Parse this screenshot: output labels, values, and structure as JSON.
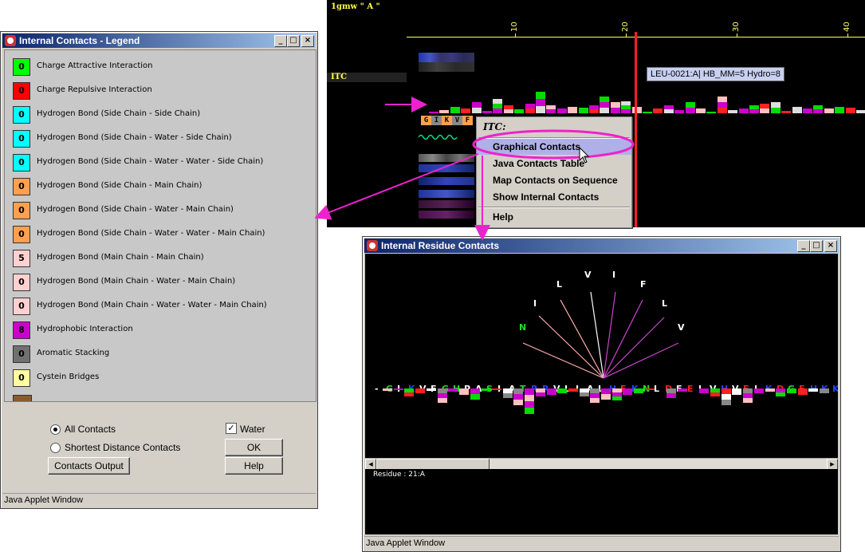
{
  "seqviewer": {
    "title": "1gmw \" A \"",
    "track_label": "ITC",
    "ruler_ticks": [
      "10",
      "20",
      "30",
      "40"
    ],
    "tooltip": "LEU-0021:A| HB_MM=5  Hydro=8",
    "sequence_letters": [
      "G",
      "I",
      "K",
      "V",
      "F"
    ]
  },
  "context_menu": {
    "title": "ITC:",
    "items": [
      {
        "label": "Graphical Contacts",
        "selected": true
      },
      {
        "label": "Java Contacts Table",
        "selected": false
      },
      {
        "label": "Map Contacts on Sequence",
        "selected": false
      },
      {
        "label": "Show Internal Contacts",
        "selected": false
      },
      {
        "label": "Help",
        "selected": false
      }
    ]
  },
  "legend_window": {
    "title": "Internal Contacts - Legend",
    "status": "Java Applet Window",
    "items": [
      {
        "count": "0",
        "color": "#00ff00",
        "label": "Charge Attractive Interaction"
      },
      {
        "count": "0",
        "color": "#ff0000",
        "label": "Charge Repulsive Interaction"
      },
      {
        "count": "0",
        "color": "#00ffff",
        "label": "Hydrogen Bond (Side Chain - Side Chain)"
      },
      {
        "count": "0",
        "color": "#00ffff",
        "label": "Hydrogen Bond (Side Chain - Water - Side Chain)"
      },
      {
        "count": "0",
        "color": "#00ffff",
        "label": "Hydrogen Bond (Side Chain - Water - Water - Side Chain)"
      },
      {
        "count": "0",
        "color": "#ffa050",
        "label": "Hydrogen Bond (Side Chain - Main Chain)"
      },
      {
        "count": "0",
        "color": "#ffa050",
        "label": "Hydrogen Bond (Side Chain - Water - Main Chain)"
      },
      {
        "count": "0",
        "color": "#ffa050",
        "label": "Hydrogen Bond (Side Chain - Water - Water - Main Chain)"
      },
      {
        "count": "5",
        "color": "#ffd0d0",
        "label": "Hydrogen Bond (Main Chain - Main Chain)"
      },
      {
        "count": "0",
        "color": "#ffd0d0",
        "label": "Hydrogen Bond (Main Chain - Water - Main Chain)"
      },
      {
        "count": "0",
        "color": "#ffd0d0",
        "label": "Hydrogen Bond (Main Chain - Water - Water - Main Chain)"
      },
      {
        "count": "8",
        "color": "#cc00cc",
        "label": "Hydrophobic Interaction"
      },
      {
        "count": "0",
        "color": "#707070",
        "label": "Aromatic Stacking"
      },
      {
        "count": "0",
        "color": "#ffffa0",
        "label": "Cystein Bridges"
      }
    ],
    "controls": {
      "all_contacts": "All Contacts",
      "shortest_distance": "Shortest Distance Contacts",
      "water": "Water",
      "ok": "OK",
      "help": "Help",
      "contacts_output": "Contacts Output"
    }
  },
  "contacts_window": {
    "title": "Internal Residue Contacts",
    "status": "Java Applet Window",
    "info": "Residue : 21:A",
    "fan_residues": [
      "N",
      "I",
      "L",
      "V",
      "I",
      "F",
      "L",
      "V"
    ],
    "sequence": [
      {
        "c": "-",
        "col": "#ffffff"
      },
      {
        "c": "G",
        "col": "#22dd22"
      },
      {
        "c": "I",
        "col": "#ffffff"
      },
      {
        "c": "K",
        "col": "#2244ff"
      },
      {
        "c": "V",
        "col": "#ffffff"
      },
      {
        "c": "F",
        "col": "#ffffff"
      },
      {
        "c": "G",
        "col": "#22dd22"
      },
      {
        "c": "H",
        "col": "#22dd22"
      },
      {
        "c": "P",
        "col": "#ffffff"
      },
      {
        "c": "A",
        "col": "#ffffff"
      },
      {
        "c": "S",
        "col": "#22dd22"
      },
      {
        "c": "I",
        "col": "#ffffff"
      },
      {
        "c": "A",
        "col": "#ffffff"
      },
      {
        "c": "T",
        "col": "#22dd22"
      },
      {
        "c": "R",
        "col": "#2244ff"
      },
      {
        "c": "R",
        "col": "#2244ff"
      },
      {
        "c": "V",
        "col": "#ffffff"
      },
      {
        "c": "L",
        "col": "#ffffff"
      },
      {
        "c": "I",
        "col": "#ffffff"
      },
      {
        "c": "A",
        "col": "#ffffff"
      },
      {
        "c": "L",
        "col": "#ffffff"
      },
      {
        "c": "H",
        "col": "#2244ff"
      },
      {
        "c": "E",
        "col": "#ff2222"
      },
      {
        "c": "K",
        "col": "#2244ff"
      },
      {
        "c": "N",
        "col": "#22dd22"
      },
      {
        "c": "L",
        "col": "#ffffff"
      },
      {
        "c": "D",
        "col": "#ff2222"
      },
      {
        "c": "F",
        "col": "#ffffff"
      },
      {
        "c": "E",
        "col": "#ff2222"
      },
      {
        "c": "L",
        "col": "#ffffff"
      },
      {
        "c": "V",
        "col": "#ffffff"
      },
      {
        "c": "H",
        "col": "#2244ff"
      },
      {
        "c": "V",
        "col": "#ffffff"
      },
      {
        "c": "E",
        "col": "#ff2222"
      },
      {
        "c": "L",
        "col": "#ffffff"
      },
      {
        "c": "K",
        "col": "#2244ff"
      },
      {
        "c": "D",
        "col": "#ff2222"
      },
      {
        "c": "G",
        "col": "#22dd22"
      },
      {
        "c": "E",
        "col": "#ff2222"
      },
      {
        "c": "H",
        "col": "#2244ff"
      },
      {
        "c": "K",
        "col": "#2244ff"
      },
      {
        "c": "K",
        "col": "#2244ff"
      }
    ]
  }
}
